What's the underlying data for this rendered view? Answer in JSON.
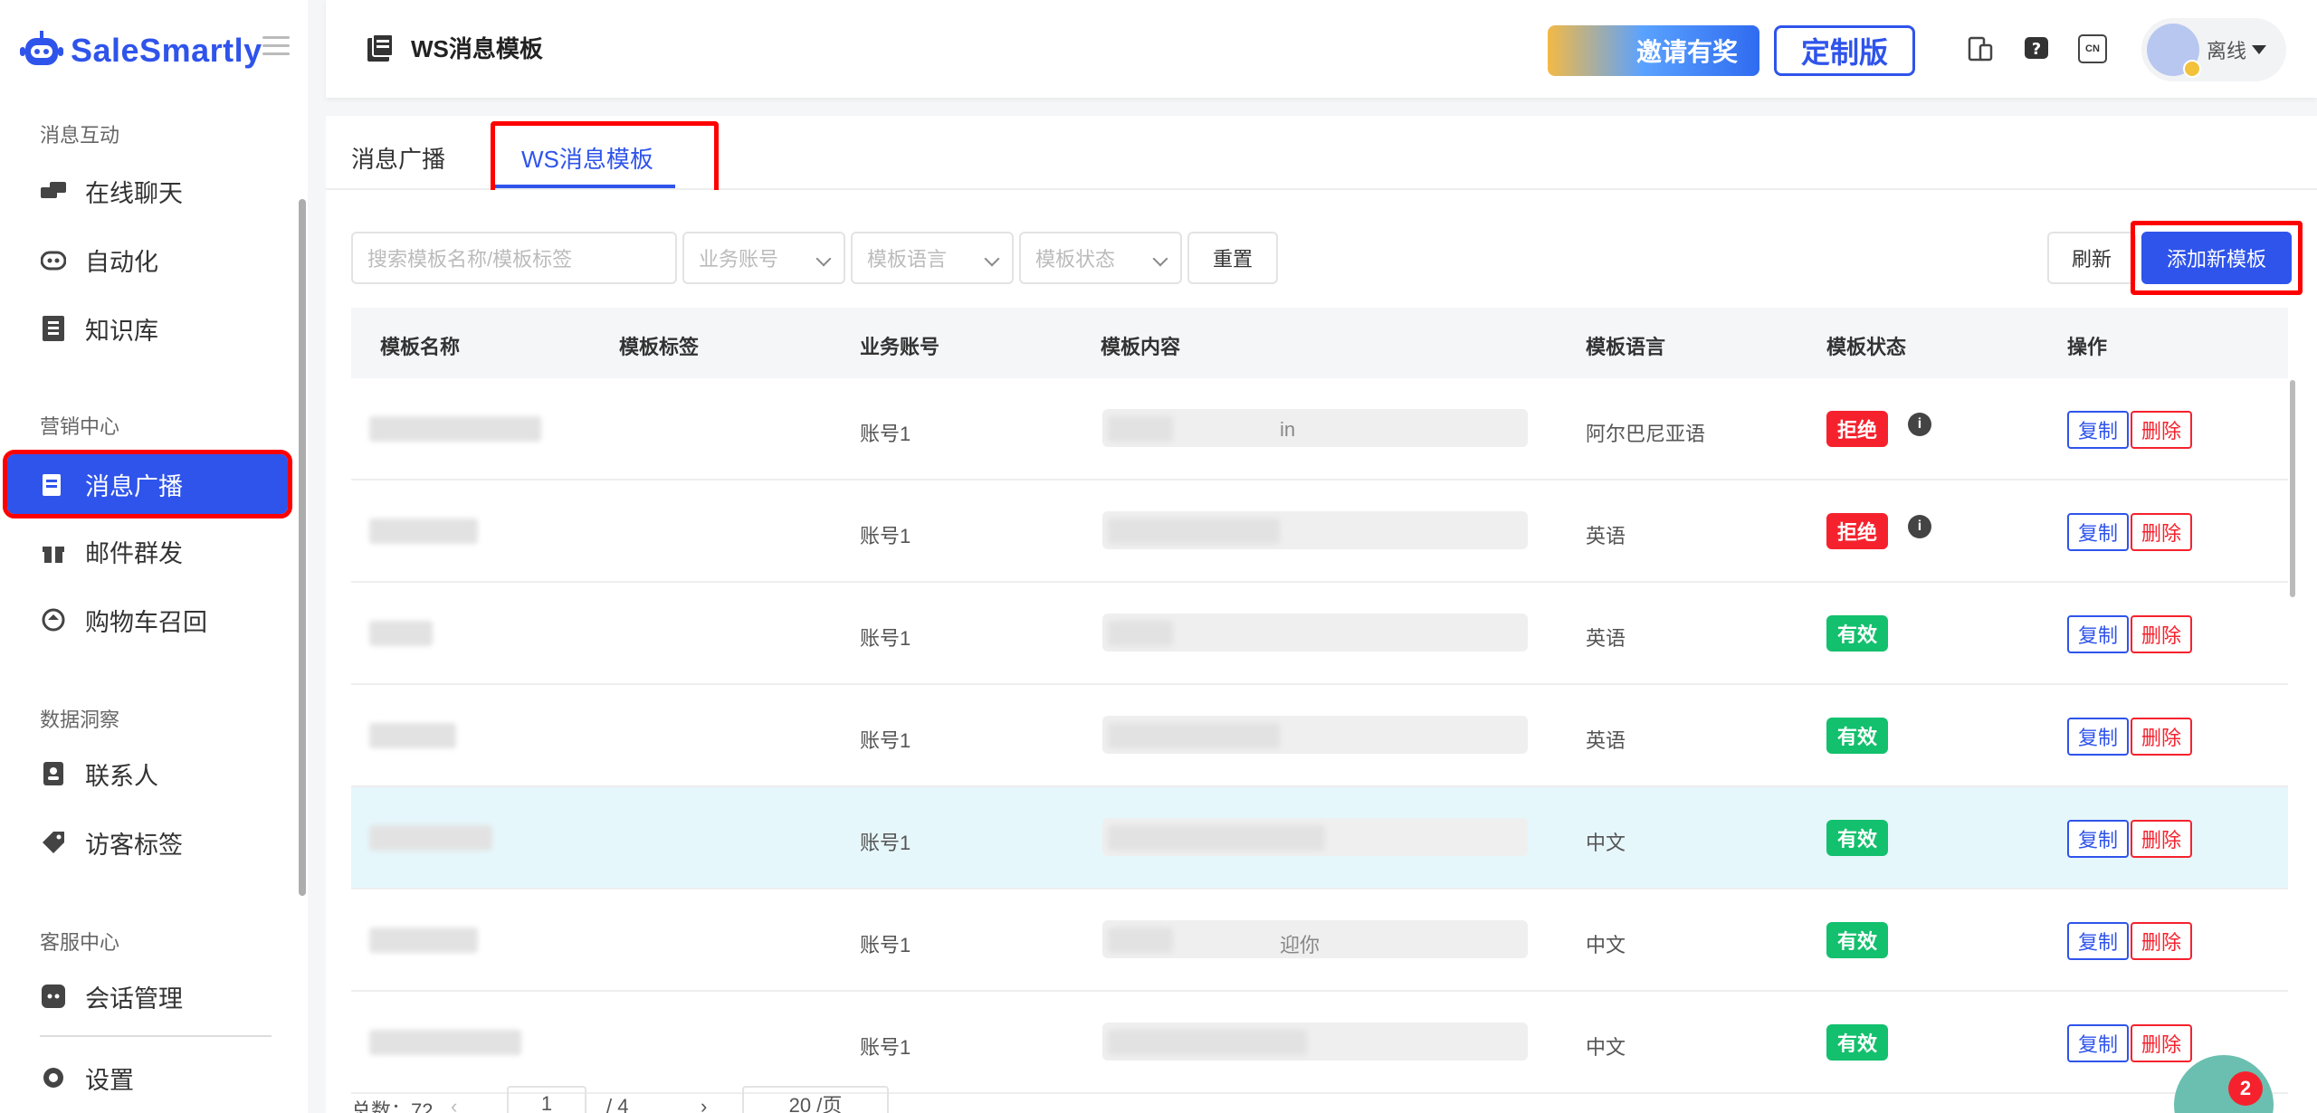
{
  "brand": {
    "name": "SaleSmartly",
    "color": "#2f54eb"
  },
  "sidebar": {
    "groups": [
      {
        "label": "消息互动",
        "items": [
          {
            "label": "在线聊天",
            "icon": "chat-icon"
          },
          {
            "label": "自动化",
            "icon": "robot-icon"
          },
          {
            "label": "知识库",
            "icon": "book-icon"
          }
        ]
      },
      {
        "label": "营销中心",
        "items": [
          {
            "label": "消息广播",
            "icon": "broadcast-icon",
            "active": true
          },
          {
            "label": "邮件群发",
            "icon": "gift-icon"
          },
          {
            "label": "购物车召回",
            "icon": "cart-recall-icon"
          }
        ]
      },
      {
        "label": "数据洞察",
        "items": [
          {
            "label": "联系人",
            "icon": "contact-icon"
          },
          {
            "label": "访客标签",
            "icon": "tag-icon"
          }
        ]
      },
      {
        "label": "客服中心",
        "items": [
          {
            "label": "会话管理",
            "icon": "session-icon"
          }
        ]
      }
    ],
    "settings": "设置"
  },
  "header": {
    "title": "WS消息模板",
    "invite": "邀请有奖",
    "custom": "定制版",
    "status": "离线",
    "lang_badge": "CN"
  },
  "tabs": [
    {
      "label": "消息广播"
    },
    {
      "label": "WS消息模板",
      "active": true
    }
  ],
  "toolbar": {
    "search_placeholder": "搜索模板名称/模板标签",
    "account_placeholder": "业务账号",
    "language_placeholder": "模板语言",
    "status_placeholder": "模板状态",
    "reset": "重置",
    "refresh": "刷新",
    "add": "添加新模板"
  },
  "table": {
    "columns": [
      "模板名称",
      "模板标签",
      "业务账号",
      "模板内容",
      "模板语言",
      "模板状态",
      "操作"
    ],
    "rows": [
      {
        "account": "账号1",
        "content_tail": "in",
        "language": "阿尔巴尼亚语",
        "status": "拒绝",
        "status_type": "rejected"
      },
      {
        "account": "账号1",
        "content_tail": "",
        "language": "英语",
        "status": "拒绝",
        "status_type": "rejected"
      },
      {
        "account": "账号1",
        "content_tail": "",
        "language": "英语",
        "status": "有效",
        "status_type": "valid"
      },
      {
        "account": "账号1",
        "content_tail": "",
        "language": "英语",
        "status": "有效",
        "status_type": "valid"
      },
      {
        "account": "账号1",
        "content_tail": "",
        "language": "中文",
        "status": "有效",
        "status_type": "valid",
        "highlight": true
      },
      {
        "account": "账号1",
        "content_tail": "迎你",
        "language": "中文",
        "status": "有效",
        "status_type": "valid"
      },
      {
        "account": "账号1",
        "content_tail": "",
        "language": "中文",
        "status": "有效",
        "status_type": "valid"
      }
    ],
    "copy": "复制",
    "delete": "删除"
  },
  "pagination": {
    "total_label": "总数：72",
    "page": "1",
    "pages": "/ 4",
    "per_page": "20 /页"
  },
  "chat_badge": "2",
  "colors": {
    "primary": "#2f54eb",
    "rejected": "#f5222d",
    "valid": "#13c06d"
  }
}
